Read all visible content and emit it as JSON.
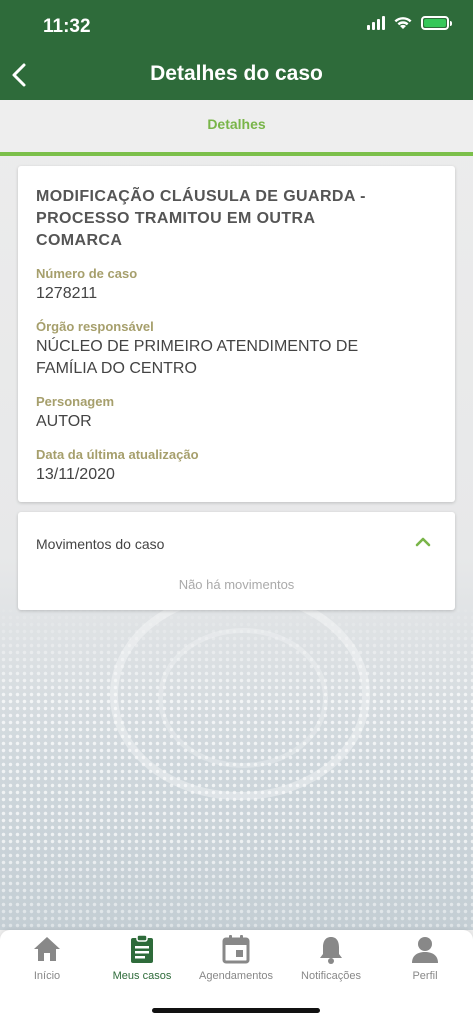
{
  "status_bar": {
    "time": "11:32"
  },
  "header": {
    "title": "Detalhes do caso"
  },
  "tabs": {
    "active": "Detalhes"
  },
  "case": {
    "title": "MODIFICAÇÃO CLÁUSULA DE GUARDA - PROCESSO TRAMITOU EM OUTRA COMARCA",
    "fields": [
      {
        "label": "Número de caso",
        "value": "1278211"
      },
      {
        "label": "Órgão responsável",
        "value": "NÚCLEO DE PRIMEIRO ATENDIMENTO DE FAMÍLIA DO CENTRO"
      },
      {
        "label": "Personagem",
        "value": "AUTOR"
      },
      {
        "label": "Data da última atualização",
        "value": "13/11/2020"
      }
    ]
  },
  "movements": {
    "title": "Movimentos do caso",
    "empty_text": "Não há movimentos",
    "expanded": true
  },
  "bottom_nav": {
    "items": [
      {
        "label": "Início",
        "icon": "home-icon"
      },
      {
        "label": "Meus casos",
        "icon": "clipboard-icon",
        "active": true
      },
      {
        "label": "Agendamentos",
        "icon": "calendar-icon"
      },
      {
        "label": "Notificações",
        "icon": "bell-icon"
      },
      {
        "label": "Perfil",
        "icon": "user-icon"
      }
    ]
  },
  "colors": {
    "primary": "#2e6b3a",
    "accent": "#79b549",
    "label": "#a69f6c"
  }
}
